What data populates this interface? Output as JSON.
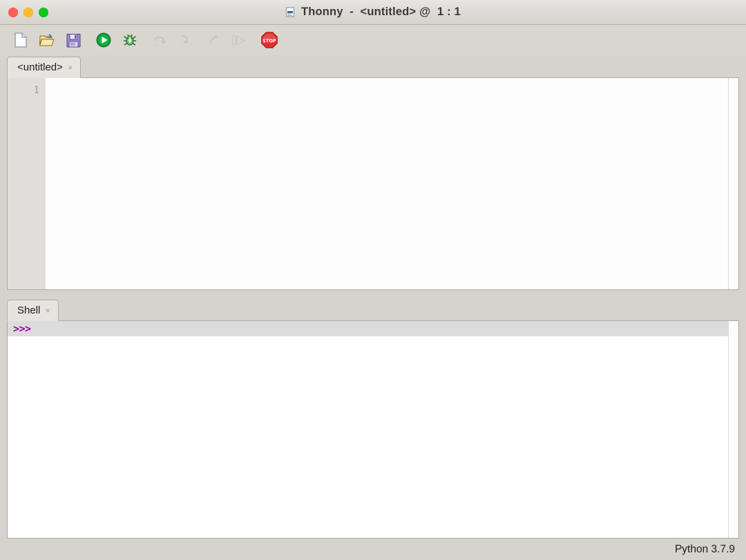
{
  "window": {
    "title": "Thonny  -  <untitled> @  1 : 1",
    "title_icon": "thonny-document-icon",
    "traffic_lights": [
      {
        "name": "close",
        "color": "#ff5e57"
      },
      {
        "name": "minimize",
        "color": "#ffbd2e"
      },
      {
        "name": "maximize",
        "color": "#0ac91c"
      }
    ]
  },
  "toolbar": {
    "buttons": [
      {
        "name": "new-file",
        "label": "New",
        "enabled": true
      },
      {
        "name": "open-file",
        "label": "Open",
        "enabled": true
      },
      {
        "name": "save-file",
        "label": "Save",
        "enabled": true
      },
      {
        "name": "run",
        "label": "Run current script",
        "enabled": true
      },
      {
        "name": "debug",
        "label": "Debug current script",
        "enabled": true
      },
      {
        "name": "step-over",
        "label": "Step over",
        "enabled": false
      },
      {
        "name": "step-into",
        "label": "Step into",
        "enabled": false
      },
      {
        "name": "step-out",
        "label": "Step out",
        "enabled": false
      },
      {
        "name": "resume",
        "label": "Resume",
        "enabled": false
      },
      {
        "name": "stop",
        "label": "Stop/Restart backend",
        "enabled": true
      }
    ]
  },
  "editor": {
    "tab": {
      "label": "<untitled>",
      "close": "×"
    },
    "line_numbers": [
      "1"
    ],
    "content": ""
  },
  "shell": {
    "tab": {
      "label": "Shell",
      "close": "×"
    },
    "prompt": ">>>",
    "output": ""
  },
  "statusbar": {
    "interpreter": "Python 3.7.9"
  },
  "colors": {
    "window_bg": "#d6d3cc",
    "panel_bg": "#ffffff",
    "gutter_bg": "#e0dedb",
    "prompt_color": "#a000a0",
    "prompt_row_bg": "#dcdcdc",
    "tab_active_bg": "#e6e4df",
    "border": "#aba79f"
  }
}
